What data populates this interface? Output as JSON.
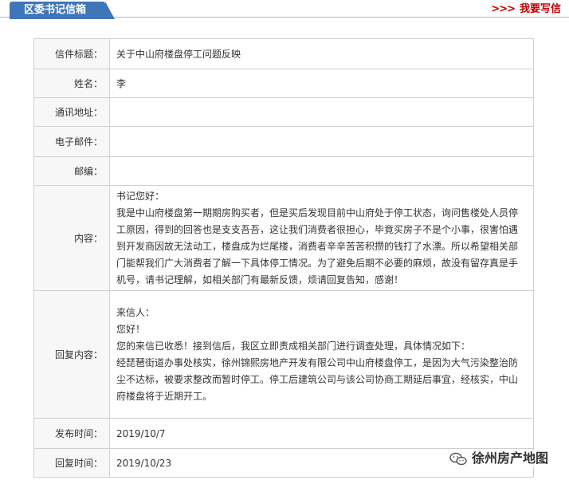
{
  "header": {
    "title": "区委书记信箱",
    "write_arrows": ">>>",
    "write_label": "我要写信"
  },
  "letter": {
    "subject_label": "信件标题：",
    "subject": "关于中山府楼盘停工问题反映",
    "name_label": "姓名：",
    "name": "李",
    "address_label": "通讯地址：",
    "address": "",
    "email_label": "电子邮件：",
    "email": "",
    "postcode_label": "邮编：",
    "postcode": "",
    "content_label": "内容：",
    "content_lines": [
      "书记您好：",
      "我是中山府楼盘第一期期房购买者，但是买后发现目前中山府处于停工状态，询问售楼处人员停工原因，得到的回答也是支支吾吾，这让我们消费者很担心，毕竟买房子不是个小事，很害怕遇到开发商因故无法动工，楼盘成为烂尾楼，消费者辛辛苦苦积攒的钱打了水漂。所以希望相关部门能帮我们广大消费者了解一下具体停工情况。为了避免后期不必要的麻烦，故没有留存真是手机号，请书记理解，如相关部门有最新反馈，烦请回复告知，感谢！"
    ],
    "reply_label": "回复内容：",
    "reply_lines": [
      "来信人：",
      "您好！",
      "您的来信已收悉！接到信后，我区立即责成相关部门进行调查处理，具体情况如下：",
      "经琵琶街道办事处核实，徐州锦熙房地产开发有限公司中山府楼盘停工，是因为大气污染整治防尘不达标，被要求整改而暂时停工。停工后建筑公司与该公司协商工期延后事宜，经核实，中山府楼盘将于近期开工。"
    ],
    "sent_label": "发布时间：",
    "sent": "2019/10/7",
    "replied_label": "回复时间：",
    "replied": "2019/10/23"
  },
  "watermark": {
    "text": "徐州房产地图",
    "icon": "wechat-icon"
  }
}
